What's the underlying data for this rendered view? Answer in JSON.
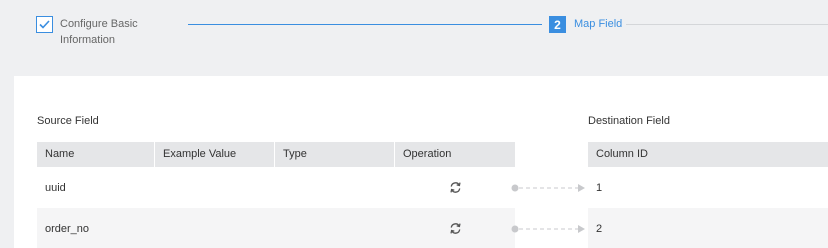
{
  "wizard": {
    "step1": {
      "label_line1": "Configure Basic",
      "label_line2": "Information"
    },
    "step2": {
      "number": "2",
      "label": "Map Field"
    },
    "accent_color": "#3a8ee0"
  },
  "source": {
    "title": "Source Field",
    "columns": [
      "Name",
      "Example Value",
      "Type",
      "Operation"
    ],
    "rows": [
      {
        "name": "uuid",
        "example_value": "",
        "type": "",
        "operation_icon": "refresh-icon"
      },
      {
        "name": "order_no",
        "example_value": "",
        "type": "",
        "operation_icon": "refresh-icon"
      }
    ]
  },
  "destination": {
    "title": "Destination Field",
    "columns": [
      "Column ID"
    ],
    "rows": [
      {
        "column_id": "1"
      },
      {
        "column_id": "2"
      }
    ]
  }
}
